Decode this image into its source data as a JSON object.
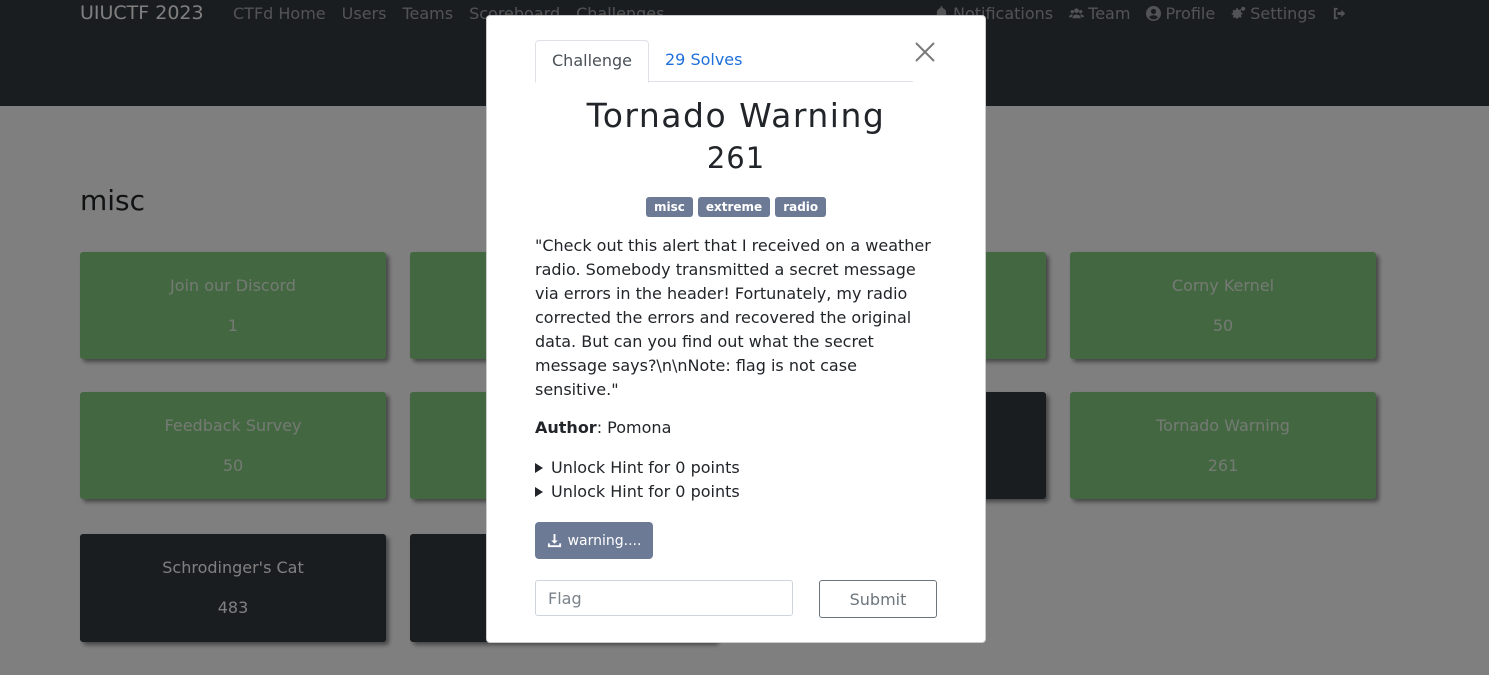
{
  "navbar": {
    "brand": "UIUCTF 2023",
    "left_links": [
      "CTFd Home",
      "Users",
      "Teams",
      "Scoreboard",
      "Challenges"
    ],
    "right_links": [
      {
        "label": "Notifications",
        "icon": "bell-icon"
      },
      {
        "label": "Team",
        "icon": "users-icon"
      },
      {
        "label": "Profile",
        "icon": "user-circle-icon"
      },
      {
        "label": "Settings",
        "icon": "gears-icon"
      },
      {
        "label": "",
        "icon": "logout-icon"
      }
    ]
  },
  "category": "misc",
  "cards": [
    {
      "name": "Join our Discord",
      "value": "1",
      "status": "solved"
    },
    {
      "name": "",
      "value": "",
      "status": "solved"
    },
    {
      "name": "",
      "value": "",
      "status": "solved"
    },
    {
      "name": "Corny Kernel",
      "value": "50",
      "status": "solved"
    },
    {
      "name": "Feedback Survey",
      "value": "50",
      "status": "solved"
    },
    {
      "name": "",
      "value": "",
      "status": "solved"
    },
    {
      "name": "",
      "value": "",
      "status": "open"
    },
    {
      "name": "Tornado Warning",
      "value": "261",
      "status": "solved"
    },
    {
      "name": "Schrodinger's Cat",
      "value": "483",
      "status": "open"
    },
    {
      "name": "",
      "value": "",
      "status": "open"
    }
  ],
  "modal": {
    "tabs": {
      "challenge": "Challenge",
      "solves": "29 Solves"
    },
    "name": "Tornado Warning",
    "value": "261",
    "tags": [
      "misc",
      "extreme",
      "radio"
    ],
    "description": "\"Check out this alert that I received on a weather radio. Somebody transmitted a secret message via errors in the header! Fortunately, my radio corrected the errors and recovered the original data. But can you find out what the secret message says?\\n\\nNote: flag is not case sensitive.\"",
    "author_label": "Author",
    "author": ": Pomona",
    "hints": [
      "Unlock Hint for 0 points",
      "Unlock Hint for 0 points"
    ],
    "file_button": "warning....",
    "flag_placeholder": "Flag",
    "submit_label": "Submit"
  }
}
